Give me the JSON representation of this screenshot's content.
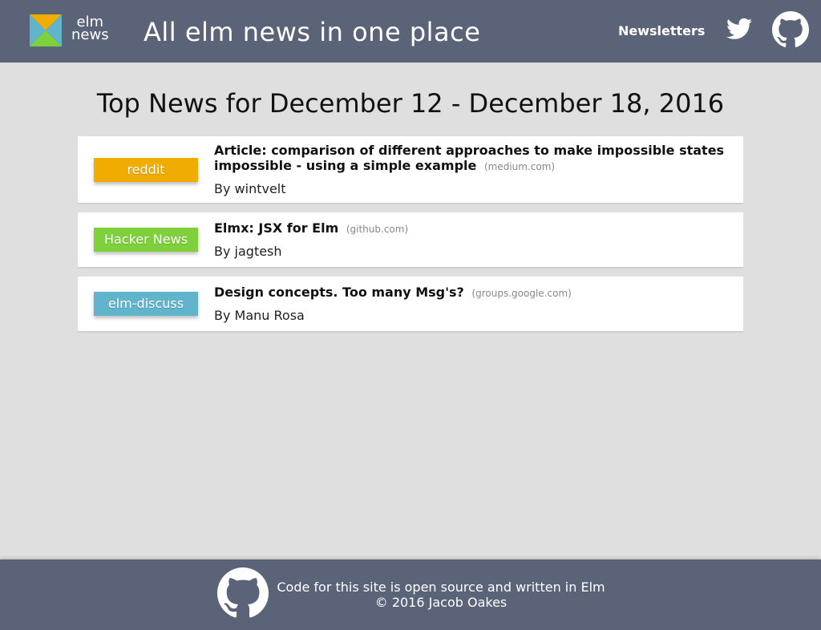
{
  "header": {
    "logo_top": "elm",
    "logo_bottom": "news",
    "title": "All elm news in one place",
    "nav": {
      "newsletters": "Newsletters",
      "twitter_icon": "twitter-icon",
      "github_icon": "github-icon"
    }
  },
  "main": {
    "heading": "Top News for December 12 - December 18, 2016",
    "items": [
      {
        "source": "reddit",
        "source_color": "#f0ad00",
        "title": "Article: comparison of different approaches to make impossible states impossible - using a simple example",
        "domain": "(medium.com)",
        "author": "By wintvelt"
      },
      {
        "source": "Hacker News",
        "source_color": "#7fd13b",
        "title": "Elmx: JSX for Elm",
        "domain": "(github.com)",
        "author": "By jagtesh"
      },
      {
        "source": "elm-discuss",
        "source_color": "#60b5cc",
        "title": "Design concepts. Too many Msg's?",
        "domain": "(groups.google.com)",
        "author": "By Manu Rosa"
      }
    ]
  },
  "footer": {
    "line1": "Code for this site is open source and written in Elm",
    "line2": "© 2016 Jacob Oakes"
  },
  "colors": {
    "header_bg": "#5a6378",
    "page_bg": "#dfdfdf"
  }
}
